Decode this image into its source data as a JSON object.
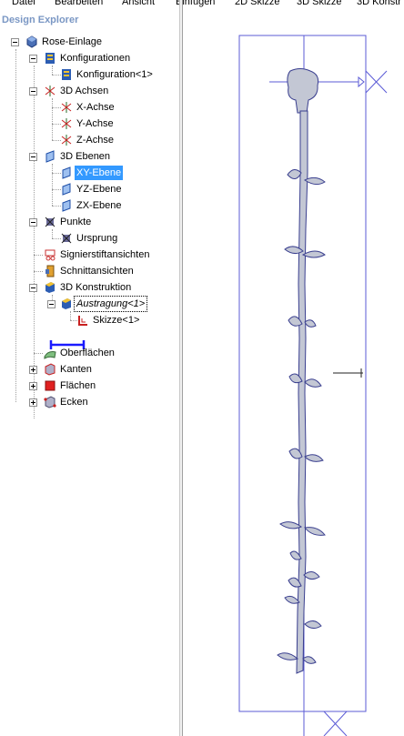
{
  "menu": {
    "items": [
      "Datei",
      "Bearbeiten",
      "Ansicht",
      "Einfügen",
      "2D Skizze",
      "3D Skizze",
      "3D Konstr"
    ]
  },
  "explorer": {
    "title": "Design Explorer",
    "tree": {
      "root": "Rose-Einlage",
      "konfigurationen": "Konfigurationen",
      "konfiguration1": "Konfiguration<1>",
      "achsen": "3D Achsen",
      "xachse": "X-Achse",
      "yachse": "Y-Achse",
      "zachse": "Z-Achse",
      "ebenen": "3D Ebenen",
      "xyebene": "XY-Ebene",
      "yzebene": "YZ-Ebene",
      "zxebene": "ZX-Ebene",
      "punkte": "Punkte",
      "ursprung": "Ursprung",
      "signierstift": "Signierstiftansichten",
      "schnitt": "Schnittansichten",
      "konstruktion": "3D Konstruktion",
      "austragung": "Austragung<1>",
      "skizze": "Skizze<1>",
      "oberflaechen": "Oberflächen",
      "kanten": "Kanten",
      "flaechen": "Flächen",
      "ecken": "Ecken"
    }
  },
  "colors": {
    "selection": "#3399ff",
    "frame": "#5b5bd6",
    "part_fill": "#c3c7d4",
    "part_outline": "#3a3f8f",
    "header": "#7a97c4"
  }
}
